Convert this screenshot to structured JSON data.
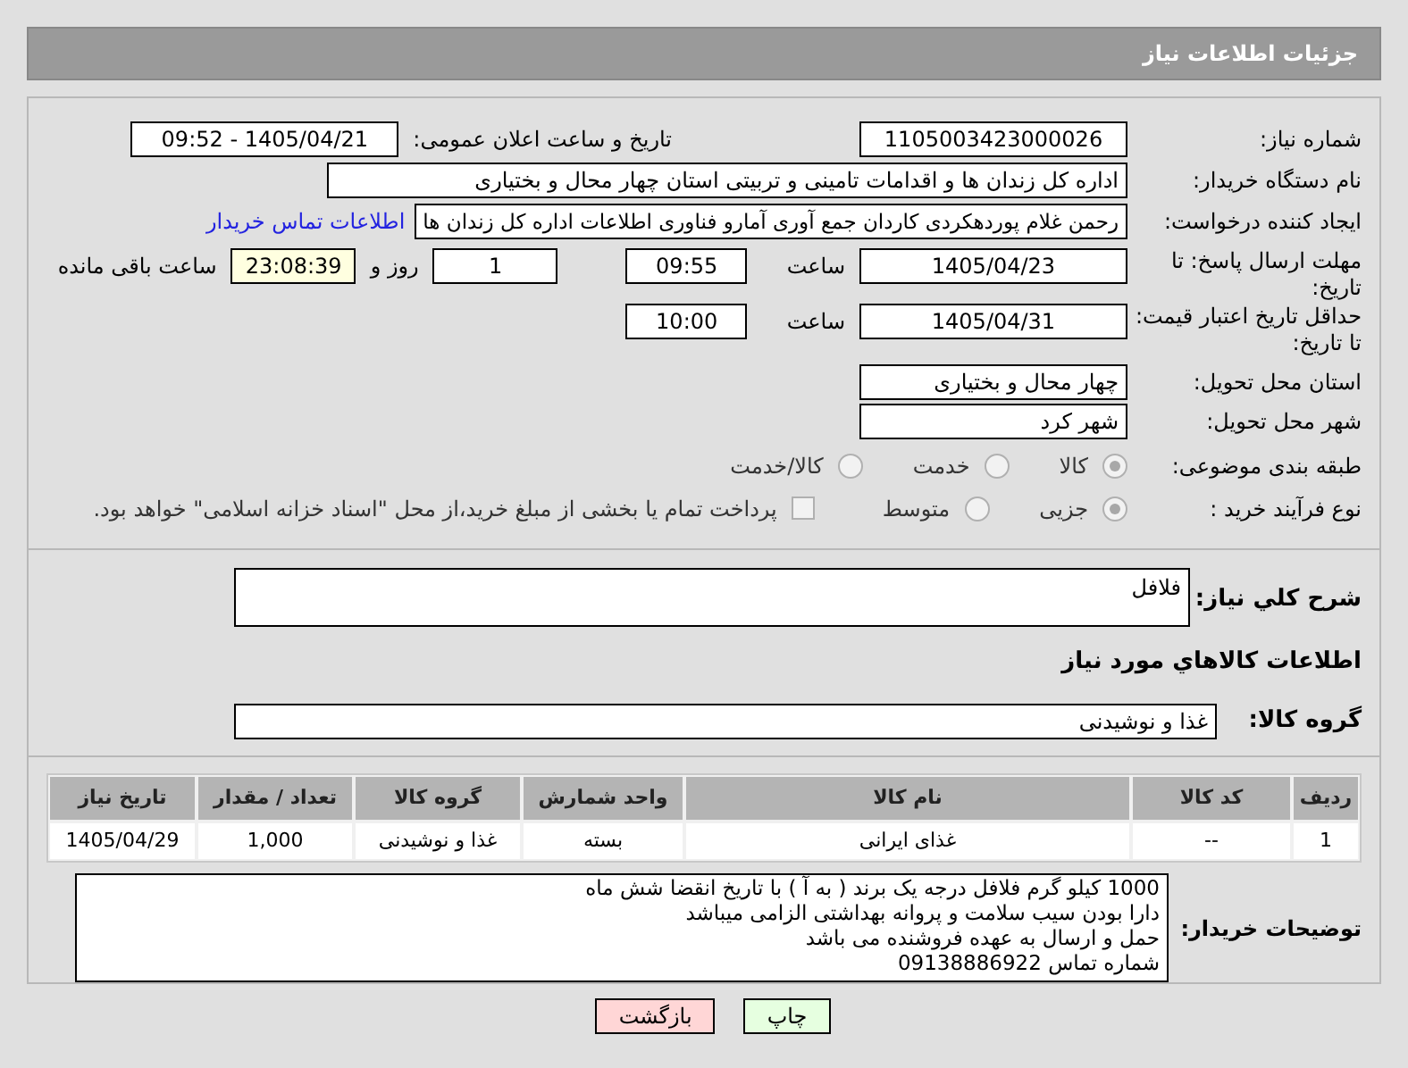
{
  "title": "جزئیات اطلاعات نیاز",
  "need_number": {
    "label": "شماره نیاز:",
    "value": "1105003423000026"
  },
  "announce": {
    "label": "تاریخ و ساعت اعلان عمومی:",
    "value": "1405/04/21 - 09:52"
  },
  "buyer": {
    "label": "نام دستگاه خریدار:",
    "value": "اداره کل زندان ها و اقدامات تامینی و تربیتی استان چهار محال و بختیاری"
  },
  "creator": {
    "label": "ایجاد کننده درخواست:",
    "value": "رحمن غلام پوردهکردی کاردان جمع آوری آمارو فناوری اطلاعات اداره کل زندان ها",
    "link": "اطلاعات تماس خریدار"
  },
  "deadline": {
    "label": "مهلت ارسال پاسخ: تا تاریخ:",
    "date": "1405/04/23",
    "time_label": "ساعت",
    "time": "09:55",
    "days": "1",
    "days_label": "روز و",
    "remaining": "23:08:39",
    "remaining_label": "ساعت باقی مانده"
  },
  "validity": {
    "label": "حداقل تاریخ اعتبار قیمت: تا تاریخ:",
    "date": "1405/04/31",
    "time_label": "ساعت",
    "time": "10:00"
  },
  "province": {
    "label": "استان محل تحویل:",
    "value": "چهار محال و بختیاری"
  },
  "city": {
    "label": "شهر محل تحویل:",
    "value": "شهر کرد"
  },
  "category": {
    "label": "طبقه بندی موضوعی:",
    "options": [
      {
        "label": "کالا",
        "selected": true
      },
      {
        "label": "خدمت",
        "selected": false
      },
      {
        "label": "کالا/خدمت",
        "selected": false
      }
    ]
  },
  "process": {
    "label": "نوع فرآیند خرید :",
    "options": [
      {
        "label": "جزیی",
        "selected": true
      },
      {
        "label": "متوسط",
        "selected": false
      }
    ],
    "payment": {
      "label": "پرداخت تمام یا بخشی از مبلغ خرید،از محل \"اسناد خزانه اسلامی\" خواهد بود.",
      "checked": false
    }
  },
  "description": {
    "label": "شرح کلي نياز:",
    "value": "فلافل"
  },
  "goods_heading": "اطلاعات کالاهاي مورد نياز",
  "goods_group": {
    "label": "گروه کالا:",
    "value": "غذا و نوشیدنی"
  },
  "table": {
    "columns": [
      "ردیف",
      "کد کالا",
      "نام کالا",
      "واحد شمارش",
      "گروه کالا",
      "تعداد / مقدار",
      "تاریخ نیاز"
    ],
    "rows": [
      [
        "1",
        "--",
        "غذای ایرانی",
        "بسته",
        "غذا و نوشیدنی",
        "1,000",
        "1405/04/29"
      ]
    ]
  },
  "notes": {
    "label": "توضیحات خریدار:",
    "lines": [
      "1000 کیلو گرم فلافل درجه یک برند ( به آ ) با تاریخ انقضا شش ماه",
      "دارا بودن سیب سلامت و پروانه بهداشتی الزامی میباشد",
      "حمل و ارسال به عهده فروشنده می باشد",
      "شماره تماس 09138886922"
    ]
  },
  "buttons": [
    {
      "label": "چاپ",
      "kind": "print"
    },
    {
      "label": "بازگشت",
      "kind": "back"
    }
  ]
}
